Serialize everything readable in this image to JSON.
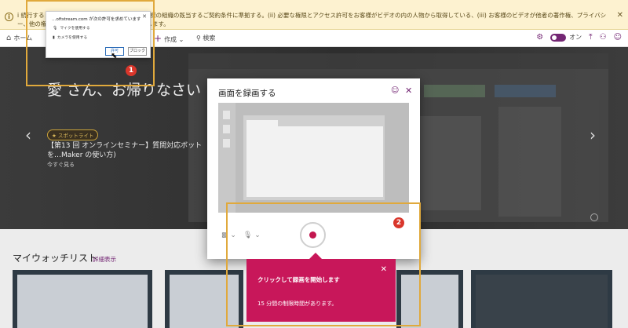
{
  "banner": {
    "icon": "info-icon",
    "text": "i 続行すると、ストリーム使用の組織の使用はお客様の組織の既当するご契約条件に準拠する。(ii) 必要な権限とアクセス許可をお客様がビデオの内の人物から取得している、(iii) お客様のビデオが他者の著作権、プライバシー、他の権限に違反していないことについて同意します。",
    "close": "✕"
  },
  "nav": {
    "home": "ホーム",
    "create": "作成",
    "search": "検索",
    "toggle_label": "オン"
  },
  "permission": {
    "title": "…oftstream.com が次の許可を求めています",
    "mic": "マイクを使用する",
    "camera": "カメラを使用する",
    "allow": "許可",
    "block": "ブロック",
    "close": "✕"
  },
  "hero": {
    "title": "愛 さん、お帰りなさい",
    "spotlight": "スポットライト",
    "description": "【第13 回 オンラインセミナー】質問対応ボットを…Maker の使い方)",
    "watch": "今すぐ見る",
    "prev": "‹",
    "next": "›"
  },
  "watchlist": {
    "title": "マイウォッチリスト",
    "more": "詳細表示"
  },
  "dialog": {
    "title": "画面を録画する",
    "smile_icon": "☺",
    "close": "✕"
  },
  "callout": {
    "title": "クリックして録画を開始します",
    "text": "15 分間の制限時間があります。",
    "close": "✕"
  },
  "annotations": {
    "one": "1",
    "two": "2"
  },
  "colors": {
    "accent": "#742774",
    "callout": "#c8175a",
    "record": "#c3174f",
    "annotation": "#e0a93c",
    "badge": "#d9362b"
  }
}
